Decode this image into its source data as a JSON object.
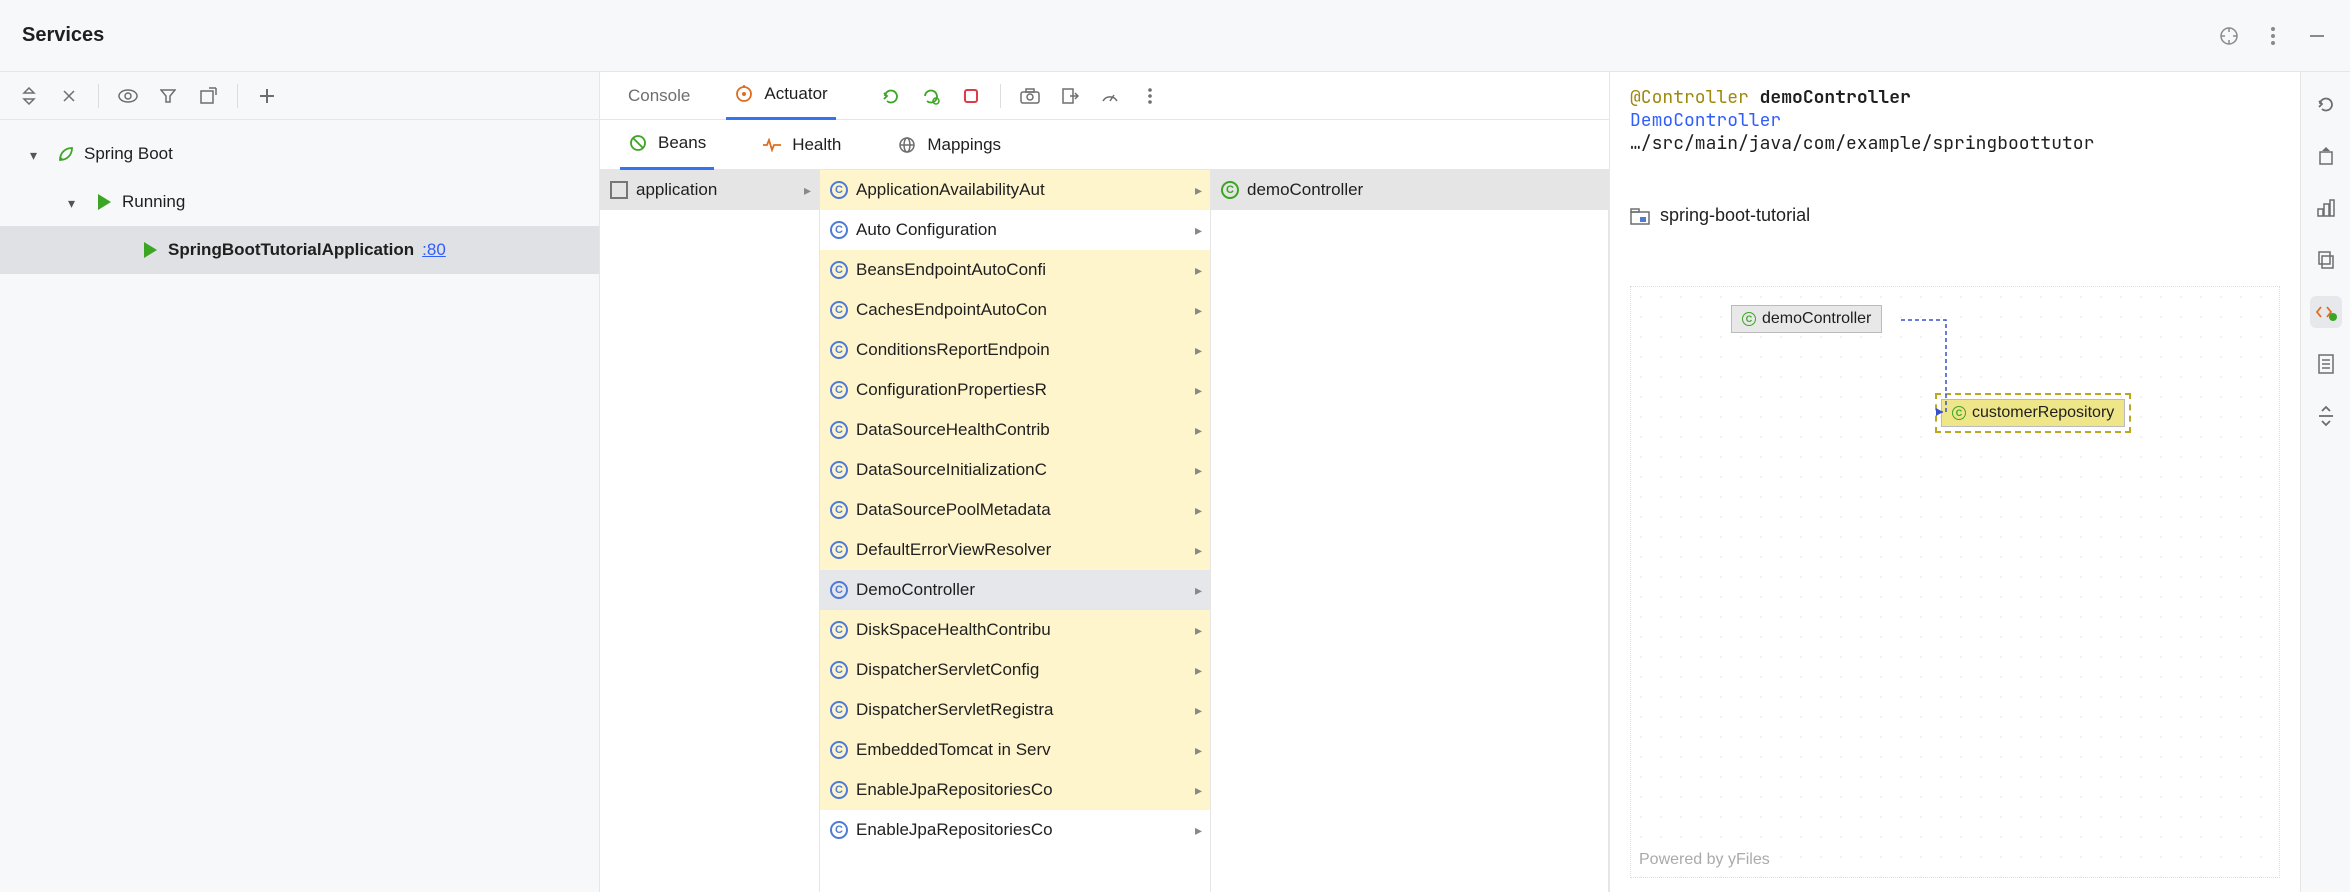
{
  "title": "Services",
  "tree": {
    "root_label": "Spring Boot",
    "group_label": "Running",
    "app_name": "SpringBootTutorialApplication",
    "app_port": ":80"
  },
  "tabs1": {
    "console": "Console",
    "actuator": "Actuator"
  },
  "tabs2": {
    "beans": "Beans",
    "health": "Health",
    "mappings": "Mappings"
  },
  "col0": {
    "item": "application"
  },
  "beans": [
    {
      "label": "ApplicationAvailabilityAut",
      "children": true,
      "hl": true
    },
    {
      "label": "Auto Configuration",
      "children": true,
      "hl": false
    },
    {
      "label": "BeansEndpointAutoConfi",
      "children": true,
      "hl": true
    },
    {
      "label": "CachesEndpointAutoCon",
      "children": true,
      "hl": true
    },
    {
      "label": "ConditionsReportEndpoin",
      "children": true,
      "hl": true
    },
    {
      "label": "ConfigurationPropertiesR",
      "children": true,
      "hl": true
    },
    {
      "label": "DataSourceHealthContrib",
      "children": true,
      "hl": true
    },
    {
      "label": "DataSourceInitializationC",
      "children": true,
      "hl": true
    },
    {
      "label": "DataSourcePoolMetadata",
      "children": true,
      "hl": true
    },
    {
      "label": "DefaultErrorViewResolver",
      "children": true,
      "hl": true
    },
    {
      "label": "DemoController",
      "children": true,
      "hl": false,
      "selected": true
    },
    {
      "label": "DiskSpaceHealthContribu",
      "children": true,
      "hl": true
    },
    {
      "label": "DispatcherServletConfig",
      "children": true,
      "hl": true
    },
    {
      "label": "DispatcherServletRegistra",
      "children": true,
      "hl": true
    },
    {
      "label": "EmbeddedTomcat in Serv",
      "children": true,
      "hl": true
    },
    {
      "label": "EnableJpaRepositoriesCo",
      "children": true,
      "hl": true
    },
    {
      "label": "EnableJpaRepositoriesCo",
      "children": true,
      "hl": false
    }
  ],
  "col2": {
    "item": "demoController"
  },
  "detail": {
    "annotation": "@Controller",
    "name": "demoController",
    "class": "DemoController",
    "path": "…/src/main/java/com/example/springboottutor",
    "module": "spring-boot-tutorial"
  },
  "diagram": {
    "node1": "demoController",
    "node2": "customerRepository",
    "powered": "Powered by yFiles"
  }
}
